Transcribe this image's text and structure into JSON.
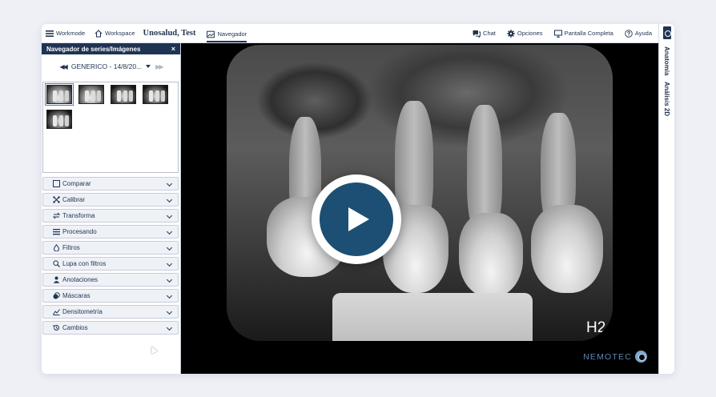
{
  "topbar": {
    "workmode_label": "Workmode",
    "workspace_label": "Workspace",
    "patient_name": "Unosalud, Test",
    "navegador_label": "Navegador",
    "chat_label": "Chat",
    "opciones_label": "Opciones",
    "pantalla_label": "Pantalla Completa",
    "ayuda_label": "Ayuda"
  },
  "right_tabs": {
    "anatomia": "Anatomía",
    "analisis": "Análisis 2D"
  },
  "series_panel": {
    "title": "Navegador de series/Imágenes",
    "close_symbol": "×",
    "series_name": "GENERICO - 14/8/20...",
    "prev_symbol": "◀◀",
    "next_symbol": "▶▶",
    "thumbnail_count": 5
  },
  "tools": [
    {
      "label": "Comparar",
      "icon": "square-icon"
    },
    {
      "label": "Calibrar",
      "icon": "calibrate-icon"
    },
    {
      "label": "Transforma",
      "icon": "transform-icon"
    },
    {
      "label": "Procesando",
      "icon": "processing-icon"
    },
    {
      "label": "Filtros",
      "icon": "drop-icon"
    },
    {
      "label": "Lupa con filtros",
      "icon": "magnifier-icon"
    },
    {
      "label": "Anotaciones",
      "icon": "person-icon"
    },
    {
      "label": "Máscaras",
      "icon": "mask-icon"
    },
    {
      "label": "Densitometría",
      "icon": "density-icon"
    },
    {
      "label": "Cambios",
      "icon": "history-icon"
    }
  ],
  "viewer": {
    "image_label": "H2",
    "brand": "NEMOTEC"
  },
  "colors": {
    "navy": "#1f3453",
    "play_button": "#1c4f73",
    "brand": "#5d86b0"
  }
}
